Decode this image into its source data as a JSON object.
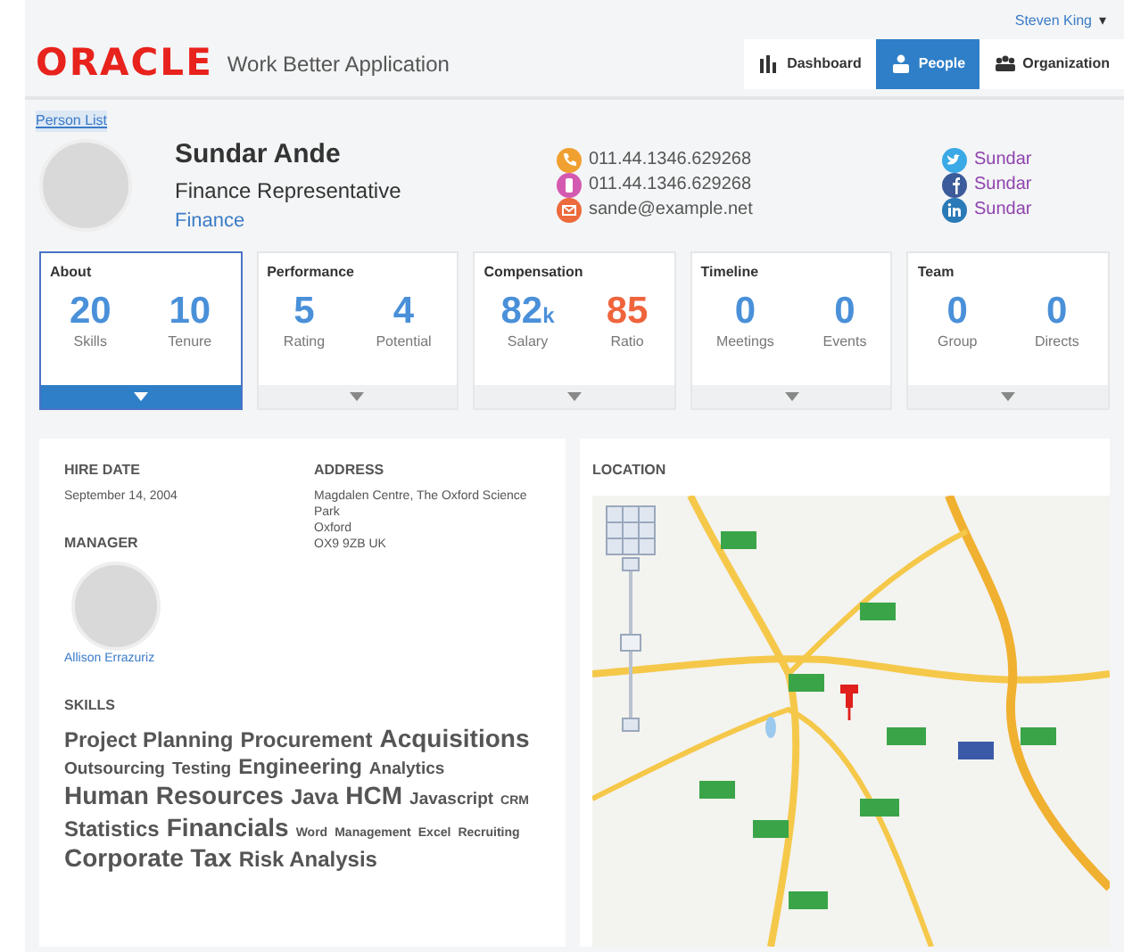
{
  "user_menu": {
    "name": "Steven King",
    "caret": "▾"
  },
  "header": {
    "logo": "ORACLE",
    "app_title": "Work Better Application"
  },
  "nav": [
    {
      "kind": "bars",
      "label": "Dashboard",
      "selected": false
    },
    {
      "kind": "person",
      "label": "People",
      "selected": true
    },
    {
      "kind": "group",
      "label": "Organization",
      "selected": false
    }
  ],
  "breadcrumb": "Person List",
  "person": {
    "name": "Sundar Ande",
    "title": "Finance Representative",
    "department": "Finance"
  },
  "contacts": [
    {
      "kind": "phone",
      "text": "011.44.1346.629268"
    },
    {
      "kind": "mobile",
      "text": "011.44.1346.629268"
    },
    {
      "kind": "email",
      "text": "sande@example.net"
    }
  ],
  "social": [
    {
      "kind": "twitter",
      "text": "Sundar"
    },
    {
      "kind": "facebook",
      "text": "Sundar"
    },
    {
      "kind": "linkedin",
      "text": "Sundar"
    }
  ],
  "cards": [
    {
      "title": "About",
      "selected": true,
      "metrics": [
        {
          "value": "20",
          "label": "Skills",
          "color": "#4a90d9"
        },
        {
          "value": "10",
          "label": "Tenure",
          "color": "#4a90d9"
        }
      ]
    },
    {
      "title": "Performance",
      "selected": false,
      "metrics": [
        {
          "value": "5",
          "label": "Rating",
          "color": "#4a90d9"
        },
        {
          "value": "4",
          "label": "Potential",
          "color": "#4a90d9"
        }
      ]
    },
    {
      "title": "Compensation",
      "selected": false,
      "metrics": [
        {
          "value": "82$_{k}$",
          "label": "Salary",
          "color": "#4a90d9"
        },
        {
          "value": "85",
          "label": "Ratio",
          "color": "#f0643c"
        }
      ]
    },
    {
      "title": "Timeline",
      "selected": false,
      "metrics": [
        {
          "value": "0",
          "label": "Meetings",
          "color": "#4a90d9"
        },
        {
          "value": "0",
          "label": "Events",
          "color": "#4a90d9"
        }
      ]
    },
    {
      "title": "Team",
      "selected": false,
      "metrics": [
        {
          "value": "0",
          "label": "Group",
          "color": "#4a90d9"
        },
        {
          "value": "0",
          "label": "Directs",
          "color": "#4a90d9"
        }
      ]
    }
  ],
  "details": {
    "hire_date_label": "HIRE DATE",
    "hire_date": "September 14, 2004",
    "address_label": "ADDRESS",
    "address_lines": [
      "Magdalen Centre, The Oxford Science Park",
      "Oxford",
      "OX9 9ZB UK"
    ],
    "manager_label": "MANAGER",
    "manager_name": "Allison Errazuriz",
    "skills_label": "SKILLS"
  },
  "skills": [
    {
      "text": "Project Planning",
      "kind": "medium"
    },
    {
      "text": "Procurement",
      "kind": "medium"
    },
    {
      "text": "Acquisitions",
      "kind": "large"
    },
    {
      "text": "Outsourcing",
      "kind": "small"
    },
    {
      "text": "Testing",
      "kind": "small"
    },
    {
      "text": "Engineering",
      "kind": "medium"
    },
    {
      "text": "Analytics",
      "kind": "small"
    },
    {
      "text": "Human Resources",
      "kind": "large"
    },
    {
      "text": "Java",
      "kind": "medium"
    },
    {
      "text": "HCM",
      "kind": "large"
    },
    {
      "text": "Javascript",
      "kind": "small"
    },
    {
      "text": "CRM",
      "kind": "tiny"
    },
    {
      "text": "Statistics",
      "kind": "medium"
    },
    {
      "text": "Financials",
      "kind": "large"
    },
    {
      "text": "Word",
      "kind": "tiny"
    },
    {
      "text": "Management",
      "kind": "tiny"
    },
    {
      "text": "Excel",
      "kind": "tiny"
    },
    {
      "text": "Recruiting",
      "kind": "tiny"
    },
    {
      "text": "Corporate Tax",
      "kind": "large"
    },
    {
      "text": "Risk Analysis",
      "kind": "medium"
    }
  ],
  "location": {
    "label": "LOCATION"
  }
}
